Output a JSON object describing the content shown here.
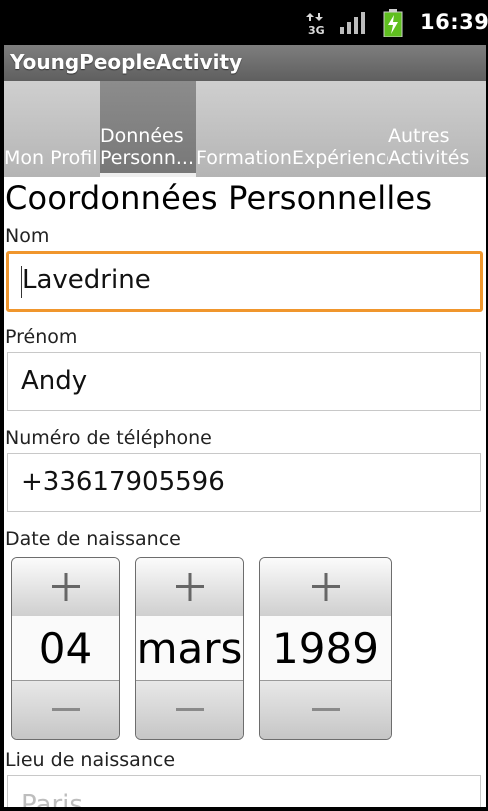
{
  "status_bar": {
    "time": "16:39",
    "network_label": "3G",
    "icons": [
      "data-arrows-icon",
      "signal-icon",
      "battery-charging-icon"
    ]
  },
  "app": {
    "title": "YoungPeopleActivity"
  },
  "tabs": [
    {
      "label": "Mon Profil",
      "selected": false
    },
    {
      "label": "Données\nPersonn...",
      "selected": true
    },
    {
      "label": "Formation",
      "selected": false
    },
    {
      "label": "Expérience",
      "selected": false
    },
    {
      "label": "Autres\nActivités",
      "selected": false
    }
  ],
  "form": {
    "section_title": "Coordonnées Personnelles",
    "nom": {
      "label": "Nom",
      "value": "Lavedrine"
    },
    "prenom": {
      "label": "Prénom",
      "value": "Andy"
    },
    "telephone": {
      "label": "Numéro de téléphone",
      "value": "+33617905596"
    },
    "date_naissance": {
      "label": "Date de naissance",
      "day": "04",
      "month": "mars",
      "year": "1989"
    },
    "lieu_naissance": {
      "label": "Lieu de naissance",
      "value": "Paris"
    }
  },
  "colors": {
    "focus_border": "#f0962d",
    "tab_selected": "#838383",
    "title_bar": "#6e6e6e"
  }
}
